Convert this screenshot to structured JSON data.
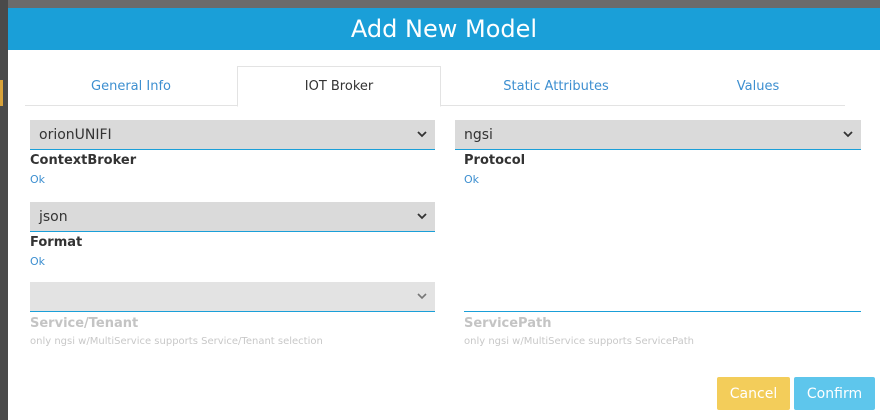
{
  "modal": {
    "title": "Add New Model"
  },
  "tabs": [
    {
      "label": "General Info",
      "active": false
    },
    {
      "label": "IOT Broker",
      "active": true
    },
    {
      "label": "Static Attributes",
      "active": false
    },
    {
      "label": "Values",
      "active": false
    }
  ],
  "fields": {
    "context_broker": {
      "value": "orionUNIFI",
      "label": "ContextBroker",
      "status": "Ok"
    },
    "protocol": {
      "value": "ngsi",
      "label": "Protocol",
      "status": "Ok"
    },
    "format": {
      "value": "json",
      "label": "Format",
      "status": "Ok"
    },
    "service_tenant": {
      "value": "",
      "label": "Service/Tenant",
      "hint": "only ngsi w/MultiService supports Service/Tenant selection"
    },
    "service_path": {
      "value": "",
      "label": "ServicePath",
      "hint": "only ngsi w/MultiService supports ServicePath"
    }
  },
  "buttons": {
    "cancel": "Cancel",
    "confirm": "Confirm"
  },
  "colors": {
    "header": "#1a9fd8",
    "tab_link": "#3d8fd0",
    "select_bg": "#dadada",
    "cancel": "#f3cd5a",
    "confirm": "#5ec6ec"
  },
  "icons": {
    "select_arrow": "chevron-down-icon"
  }
}
